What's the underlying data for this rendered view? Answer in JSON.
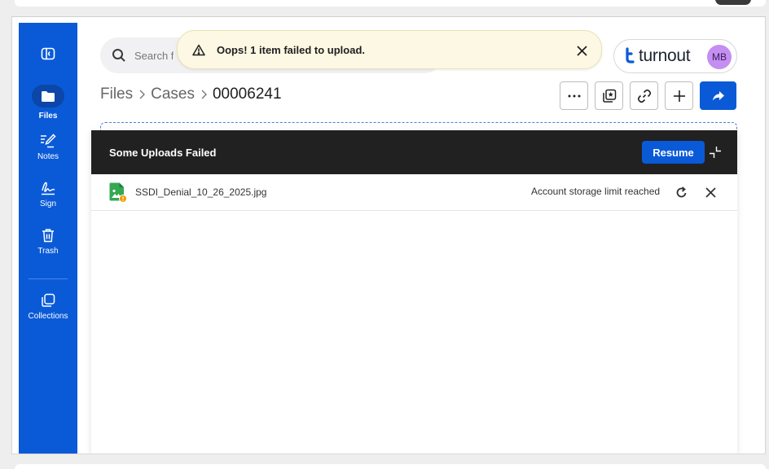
{
  "search": {
    "placeholder": "Search files"
  },
  "toast": {
    "message": "Oops! 1 item failed to upload.",
    "icon": "warning-icon"
  },
  "brand": {
    "name": "turnout",
    "avatar_initials": "MB",
    "avatar_color": "#c48ef2",
    "accent": "#0a5ad8"
  },
  "sidebar": {
    "items": [
      {
        "label": "",
        "icon": "sidebar-toggle-icon"
      },
      {
        "label": "Files",
        "icon": "folder-icon",
        "active": true
      },
      {
        "label": "Notes",
        "icon": "notes-icon"
      },
      {
        "label": "Sign",
        "icon": "signature-icon"
      },
      {
        "label": "Trash",
        "icon": "trash-icon"
      },
      {
        "label": "Collections",
        "icon": "collections-icon"
      }
    ]
  },
  "breadcrumb": {
    "items": [
      "Files",
      "Cases"
    ],
    "current": "00006241"
  },
  "toolbar": {
    "buttons": [
      "more-icon",
      "star-folder-icon",
      "link-icon",
      "plus-icon",
      "share-icon"
    ]
  },
  "upload_panel": {
    "title": "Some Uploads Failed",
    "resume_label": "Resume",
    "files": [
      {
        "name": "SSDI_Denial_10_26_2025.jpg",
        "status": "Account storage limit reached"
      }
    ]
  }
}
